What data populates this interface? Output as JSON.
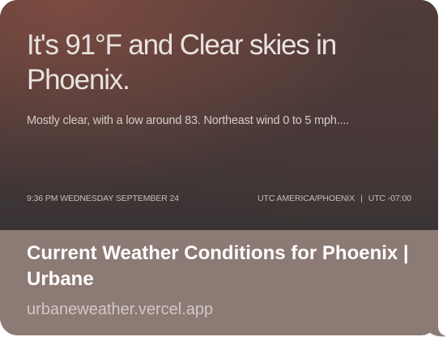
{
  "preview": {
    "headline": "It's 91°F and Clear skies in Phoenix.",
    "description": "Mostly clear, with a low around 83. Northeast wind 0 to 5 mph....",
    "timestamp": "9:36 PM WEDNESDAY SEPTEMBER 24",
    "timezone": "UTC AMERICA/PHOENIX",
    "separator": "|",
    "utc_offset": "UTC -07:00"
  },
  "link": {
    "title": "Current Weather Conditions for Phoenix | Urbane",
    "domain": "urbaneweather.vercel.app"
  },
  "colors": {
    "bubble": "#8c7a74",
    "title_text": "#ffffff",
    "domain_text": "#d2c8c4"
  }
}
